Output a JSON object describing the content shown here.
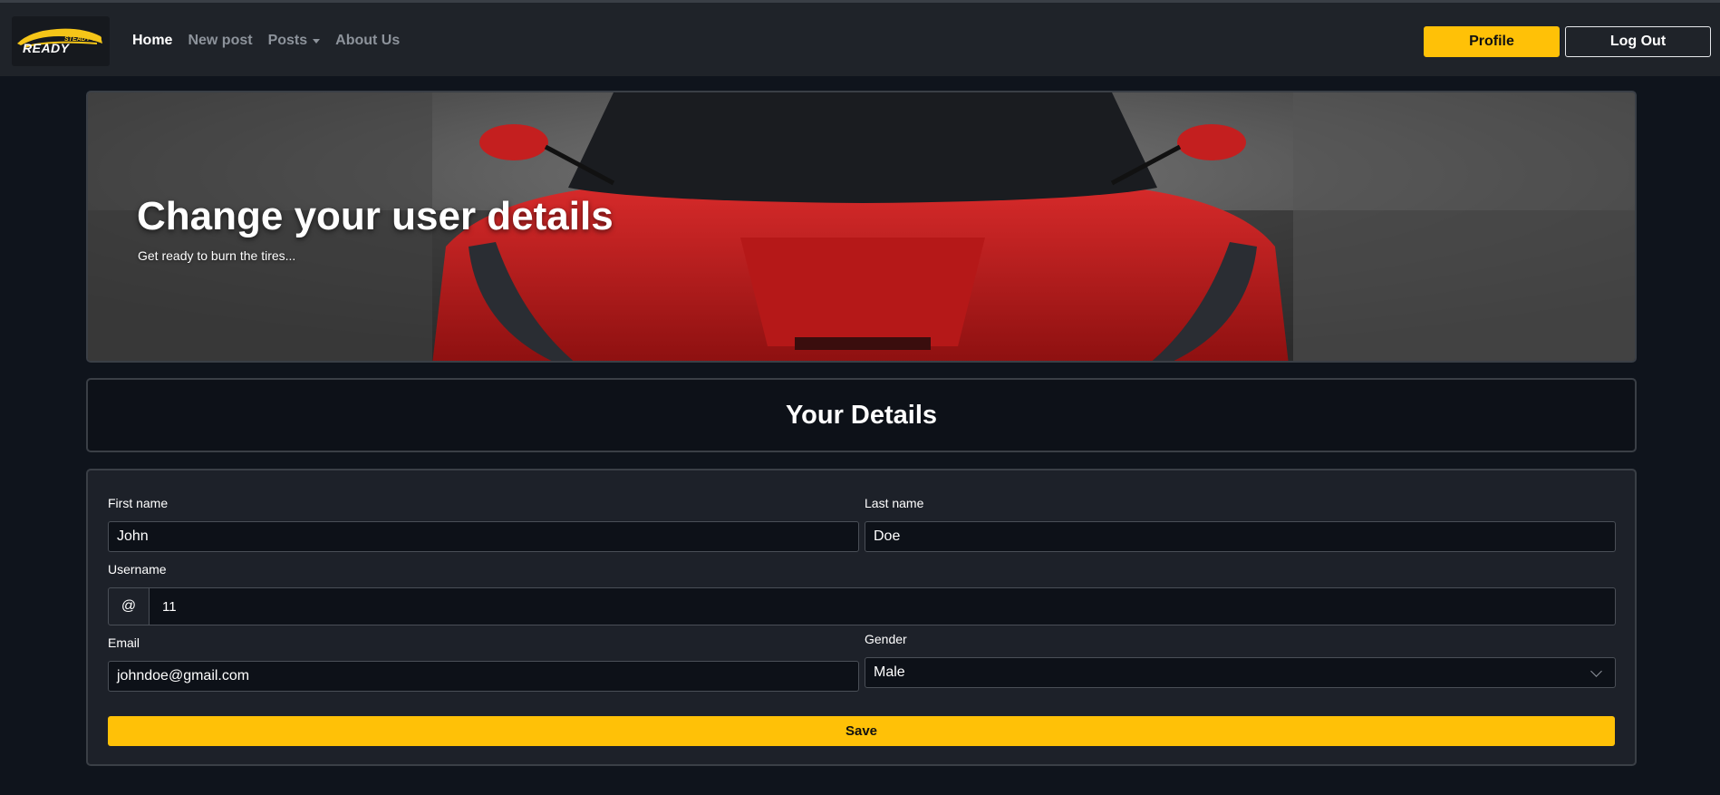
{
  "brand": {
    "logo_text": "READY",
    "logo_small": "STEADY GO"
  },
  "nav": {
    "links": [
      "Home",
      "New post",
      "Posts",
      "About Us"
    ],
    "profile_label": "Profile",
    "logout_label": "Log Out"
  },
  "hero": {
    "title": "Change your user details",
    "subtitle": "Get ready to burn the tires..."
  },
  "details": {
    "title": "Your Details"
  },
  "form": {
    "first_name": {
      "label": "First name",
      "value": "John"
    },
    "last_name": {
      "label": "Last name",
      "value": "Doe"
    },
    "username": {
      "label": "Username",
      "prefix": "@",
      "value": "11"
    },
    "email": {
      "label": "Email",
      "value": "johndoe@gmail.com"
    },
    "gender": {
      "label": "Gender",
      "value": "Male"
    },
    "save_label": "Save"
  },
  "colors": {
    "accent": "#ffc107",
    "navbar_bg": "#1f2329",
    "page_bg": "#0f141c",
    "car_red": "#c81d1d"
  }
}
